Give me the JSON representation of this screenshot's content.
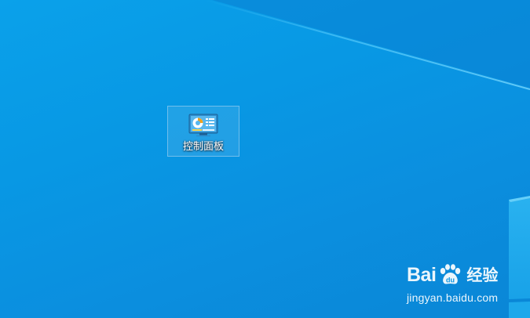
{
  "desktop": {
    "background_color": "#0a96e2",
    "icons": [
      {
        "label": "控制面板",
        "icon": "control-panel-icon",
        "selected": true
      }
    ]
  },
  "watermark": {
    "logo_bai": "Bai",
    "logo_du": "du",
    "logo_suffix": "经验",
    "url": "jingyan.baidu.com",
    "paw_icon": "baidu-paw-icon"
  }
}
